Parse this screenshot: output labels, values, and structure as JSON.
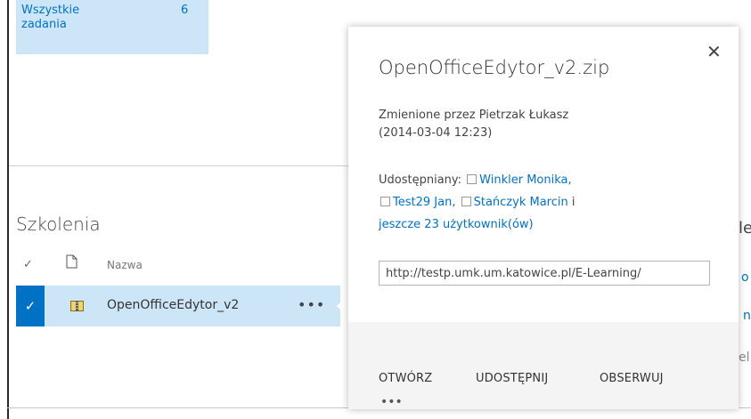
{
  "tile": {
    "label": "Wszystkie zadania",
    "count": "6"
  },
  "section": {
    "title": "Szkolenia"
  },
  "list": {
    "header_check": "✓",
    "header_name": "Nazwa",
    "row_check": "✓",
    "row_name": "OpenOfficeEdytor_v2",
    "row_menu": "•••"
  },
  "popup": {
    "close": "✕",
    "title": "OpenOfficeEdytor_v2.zip",
    "modified_by": "Zmienione przez Pietrzak Łukasz",
    "modified_date": "(2014-03-04 12:23)",
    "shared_label": "Udostępniany:",
    "users": [
      "Winkler Monika,",
      "Test29 Jan,",
      "Stańczyk Marcin"
    ],
    "and": "i",
    "more_users": "jeszcze 23 użytkownik(ów)",
    "url": "http://testp.umk.um.katowice.pl/E-Learning/",
    "actions": {
      "open": "OTWÓRZ",
      "share": "UDOSTĘPNIJ",
      "follow": "OBSERWUJ",
      "more": "•••"
    }
  },
  "right_clip": {
    "l": "le",
    "o": "o",
    "n": "nic",
    "el": "el"
  }
}
